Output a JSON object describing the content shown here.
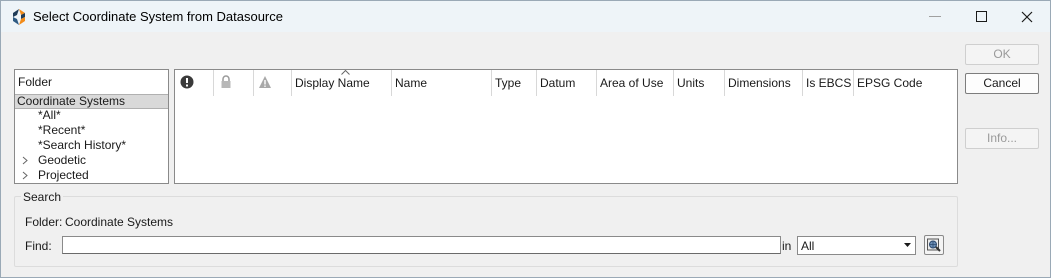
{
  "window": {
    "title": "Select Coordinate System from Datasource"
  },
  "folder_panel": {
    "header": "Folder",
    "items": [
      {
        "label": "Coordinate Systems",
        "selected": true,
        "expander": ""
      },
      {
        "label": "*All*",
        "selected": false,
        "expander": ""
      },
      {
        "label": "*Recent*",
        "selected": false,
        "expander": ""
      },
      {
        "label": "*Search History*",
        "selected": false,
        "expander": ""
      },
      {
        "label": "Geodetic",
        "selected": false,
        "expander": "chevron-right-icon"
      },
      {
        "label": "Projected",
        "selected": false,
        "expander": "chevron-right-icon"
      }
    ]
  },
  "grid": {
    "icon_columns": [
      "alert-icon",
      "lock-icon",
      "warning-icon"
    ],
    "columns": [
      "Display Name",
      "Name",
      "Type",
      "Datum",
      "Area of Use",
      "Units",
      "Dimensions",
      "Is EBCS",
      "EPSG Code"
    ],
    "sorted_column": "Display Name",
    "sort_direction": "ascending",
    "rows": []
  },
  "buttons": {
    "ok": "OK",
    "cancel": "Cancel",
    "info": "Info..."
  },
  "search": {
    "legend": "Search",
    "folder_label": "Folder:",
    "folder_value": "Coordinate Systems",
    "find_label": "Find:",
    "find_value": "",
    "in_label": "in",
    "scope_value": "All"
  },
  "colors": {
    "titlebar": "#eef4f8",
    "dialog_bg": "#f0f0f0",
    "selected_row": "#d9d9d9",
    "disabled_text": "#9a9a9a"
  }
}
